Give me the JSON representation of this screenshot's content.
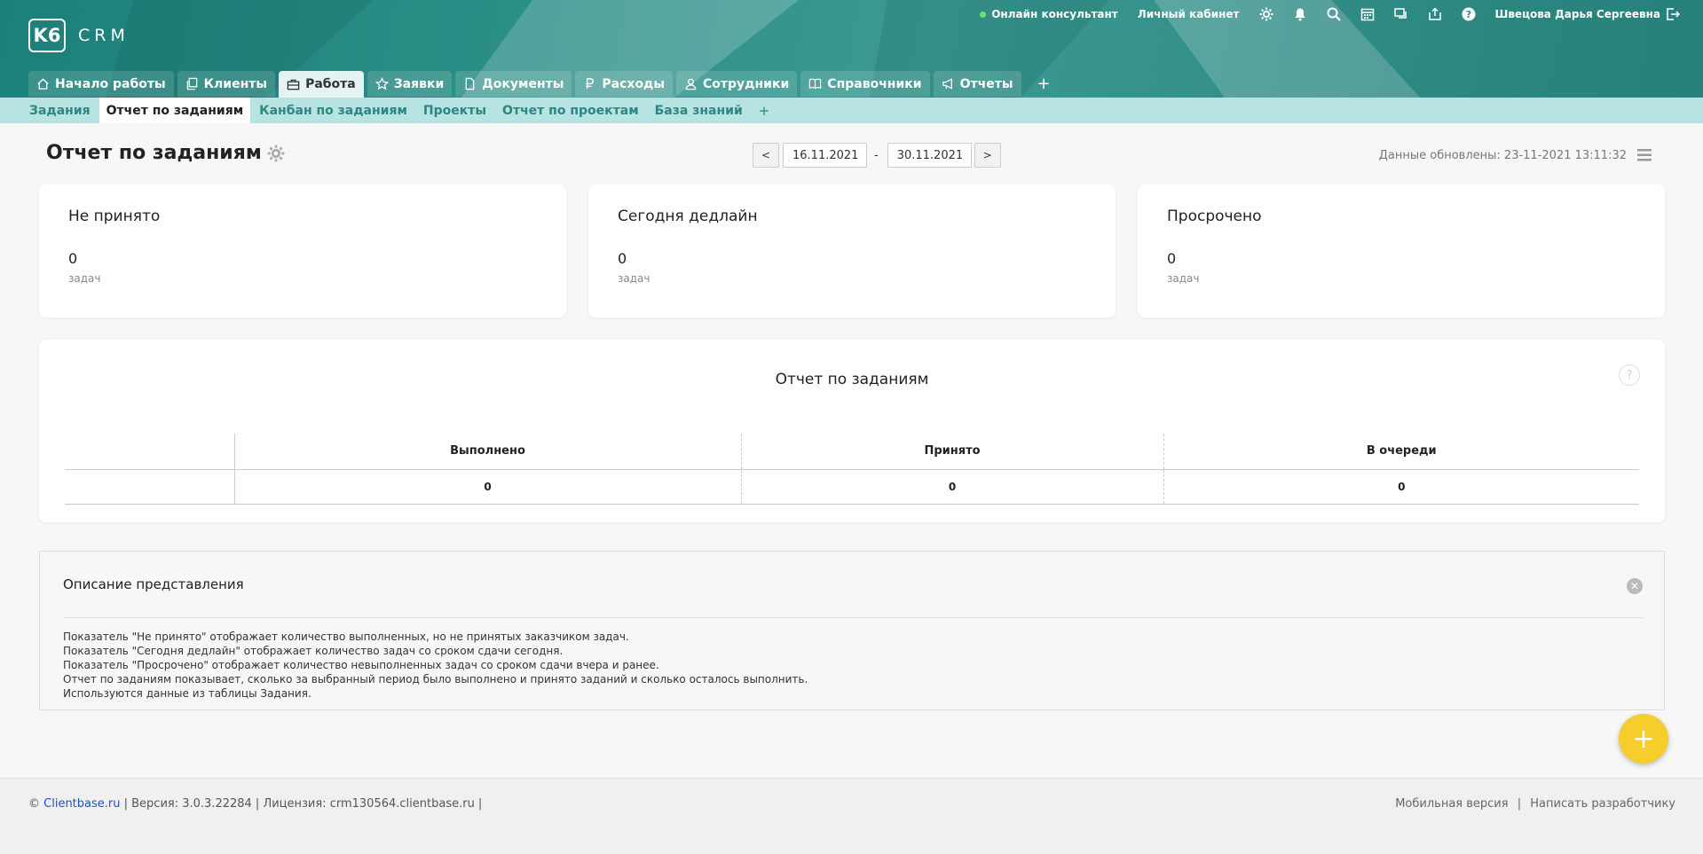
{
  "brand": {
    "logo_mark": "K6",
    "logo_text": "CRM"
  },
  "topbar": {
    "online_consultant": "Онлайн консультант",
    "personal_cabinet": "Личный кабинет",
    "user_name": "Швецова Дарья Сергеевна"
  },
  "tabs": [
    {
      "label": "Начало работы",
      "icon": "home-icon"
    },
    {
      "label": "Клиенты",
      "icon": "copy-icon"
    },
    {
      "label": "Работа",
      "icon": "briefcase-icon"
    },
    {
      "label": "Заявки",
      "icon": "star-icon"
    },
    {
      "label": "Документы",
      "icon": "document-icon"
    },
    {
      "label": "Расходы",
      "icon": "ruble-icon"
    },
    {
      "label": "Сотрудники",
      "icon": "users-icon"
    },
    {
      "label": "Справочники",
      "icon": "book-icon"
    },
    {
      "label": "Отчеты",
      "icon": "megaphone-icon"
    }
  ],
  "tab_add": "+",
  "subtabs": [
    {
      "label": "Задания"
    },
    {
      "label": "Отчет по заданиям"
    },
    {
      "label": "Канбан по заданиям"
    },
    {
      "label": "Проекты"
    },
    {
      "label": "Отчет по проектам"
    },
    {
      "label": "База знаний"
    }
  ],
  "subtab_add": "+",
  "page": {
    "title": "Отчет по заданиям",
    "date_prev": "<",
    "date_next": ">",
    "date_from": "16.11.2021",
    "date_sep": "-",
    "date_to": "30.11.2021",
    "updated": "Данные обновлены: 23-11-2021 13:11:32"
  },
  "stats": [
    {
      "title": "Не принято",
      "value": "0",
      "unit": "задач"
    },
    {
      "title": "Сегодня дедлайн",
      "value": "0",
      "unit": "задач"
    },
    {
      "title": "Просрочено",
      "value": "0",
      "unit": "задач"
    }
  ],
  "report": {
    "title": "Отчет по заданиям",
    "help": "?",
    "headers": [
      "",
      "Выполнено",
      "Принято",
      "В очереди"
    ],
    "row": [
      "",
      "0",
      "0",
      "0"
    ]
  },
  "description": {
    "title": "Описание представления",
    "lines": [
      "Показатель \"Не принято\" отображает количество выполненных, но не принятых заказчиком задач.",
      "Показатель \"Сегодня дедлайн\" отображает количество задач со сроком сдачи сегодня.",
      "Показатель \"Просрочено\" отображает количество невыполненных задач со сроком сдачи вчера и ранее.",
      "Отчет по заданиям показывает, сколько за выбранный период было выполнено и принято заданий и сколько осталось выполнить.",
      "Используются данные из таблицы Задания."
    ]
  },
  "fab": "+",
  "footer": {
    "copyright": "©",
    "site_link": "Clientbase.ru",
    "version": "| Версия: 3.0.3.22284 | Лицензия: crm130564.clientbase.ru |",
    "mobile": "Мобильная версия",
    "sep": "|",
    "write_dev": "Написать разработчику"
  }
}
